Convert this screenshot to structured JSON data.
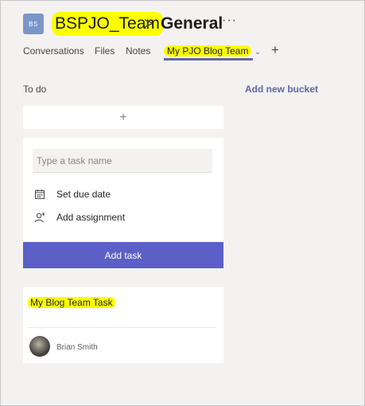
{
  "header": {
    "team_initials": "BS",
    "team_name": "BSPJO_Team",
    "separator": ">",
    "channel_name": "General",
    "more_icon": "more-horizontal-icon",
    "more_glyph": "···"
  },
  "tabs": [
    {
      "label": "Conversations"
    },
    {
      "label": "Files"
    },
    {
      "label": "Notes"
    },
    {
      "label": "My PJO Blog Team",
      "active": true
    }
  ],
  "active_tab_chevron": "⌄",
  "add_tab_glyph": "+",
  "board": {
    "column_title": "To do",
    "add_bucket_label": "Add new bucket",
    "add_row_glyph": "+",
    "new_task": {
      "placeholder": "Type a task name",
      "due_date_label": "Set due date",
      "assignment_label": "Add assignment",
      "submit_label": "Add task"
    },
    "tasks": [
      {
        "title": "My Blog Team Task",
        "assignee": "Brian Smith"
      }
    ]
  },
  "colors": {
    "accent": "#6264a7",
    "button": "#5b5fc7",
    "highlight": "#fbff00",
    "team_avatar": "#7b95c9",
    "background": "#f3f2f1"
  }
}
